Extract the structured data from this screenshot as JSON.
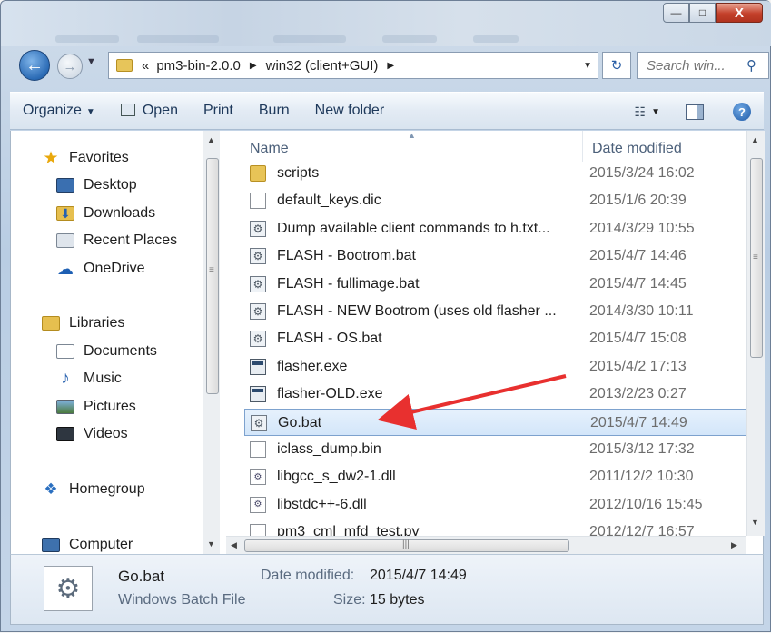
{
  "window": {
    "caption_buttons": {
      "minimize": "—",
      "maximize": "□",
      "close": "X"
    }
  },
  "navigation": {
    "back_glyph": "←",
    "forward_glyph": "→",
    "breadcrumb_prefix": "«",
    "breadcrumbs": [
      "pm3-bin-2.0.0",
      "win32 (client+GUI)"
    ],
    "refresh_glyph": "↻",
    "search_placeholder": "Search win...",
    "search_glyph": "⚲"
  },
  "command_bar": {
    "organize": "Organize",
    "open": "Open",
    "print": "Print",
    "burn": "Burn",
    "new_folder": "New folder",
    "help_glyph": "?"
  },
  "nav_pane": {
    "favorites": {
      "label": "Favorites",
      "items": [
        "Desktop",
        "Downloads",
        "Recent Places",
        "OneDrive"
      ]
    },
    "libraries": {
      "label": "Libraries",
      "items": [
        "Documents",
        "Music",
        "Pictures",
        "Videos"
      ]
    },
    "homegroup": "Homegroup",
    "computer": "Computer"
  },
  "columns": {
    "name": "Name",
    "date_modified": "Date modified"
  },
  "files": [
    {
      "name": "scripts",
      "date": "2015/3/24 16:02",
      "icon": "folder-icon"
    },
    {
      "name": "default_keys.dic",
      "date": "2015/1/6 20:39",
      "icon": "document-icon"
    },
    {
      "name": "Dump available client commands to h.txt...",
      "date": "2014/3/29 10:55",
      "icon": "batch-file-icon"
    },
    {
      "name": "FLASH - Bootrom.bat",
      "date": "2015/4/7 14:46",
      "icon": "batch-file-icon"
    },
    {
      "name": "FLASH - fullimage.bat",
      "date": "2015/4/7 14:45",
      "icon": "batch-file-icon"
    },
    {
      "name": "FLASH - NEW Bootrom (uses old flasher ...",
      "date": "2014/3/30 10:11",
      "icon": "batch-file-icon"
    },
    {
      "name": "FLASH - OS.bat",
      "date": "2015/4/7 15:08",
      "icon": "batch-file-icon"
    },
    {
      "name": "flasher.exe",
      "date": "2015/4/2 17:13",
      "icon": "exe-icon"
    },
    {
      "name": "flasher-OLD.exe",
      "date": "2013/2/23 0:27",
      "icon": "exe-icon"
    },
    {
      "name": "Go.bat",
      "date": "2015/4/7 14:49",
      "icon": "batch-file-icon",
      "selected": true
    },
    {
      "name": "iclass_dump.bin",
      "date": "2015/3/12 17:32",
      "icon": "document-icon"
    },
    {
      "name": "libgcc_s_dw2-1.dll",
      "date": "2011/12/2 10:30",
      "icon": "dll-icon"
    },
    {
      "name": "libstdc++-6.dll",
      "date": "2012/10/16 15:45",
      "icon": "dll-icon"
    },
    {
      "name": "pm3_cml_mfd_test.py",
      "date": "2012/12/7 16:57",
      "icon": "document-icon"
    }
  ],
  "details": {
    "file_name": "Go.bat",
    "file_type": "Windows Batch File",
    "date_label": "Date modified:",
    "date_value": "2015/4/7 14:49",
    "size_label": "Size:",
    "size_value": "15 bytes"
  },
  "colors": {
    "selection": "#d3e6fa",
    "annotation_arrow": "#e8302f"
  }
}
